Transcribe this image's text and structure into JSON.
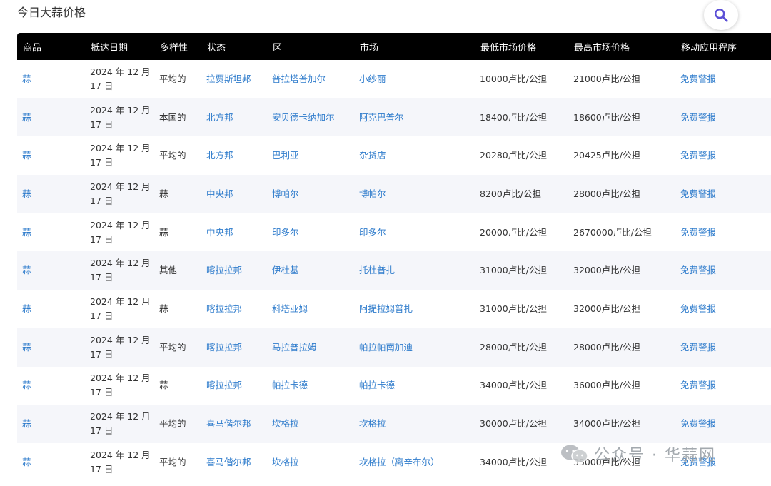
{
  "page_title": "今日大蒜价格",
  "search": {
    "icon": "search-icon",
    "accent": "#5b4fd6"
  },
  "table": {
    "headers": [
      "商品",
      "抵达日期",
      "多样性",
      "状态",
      "区",
      "市场",
      "最低市场价格",
      "最高市场价格",
      "移动应用程序"
    ],
    "rows": [
      {
        "commodity": "蒜",
        "date": "2024 年 12 月 17 日",
        "variety": "平均的",
        "state": "拉贾斯坦邦",
        "district": "普拉塔普加尔",
        "market": "小纱丽",
        "min": "10000卢比/公担",
        "max": "21000卢比/公担",
        "app": "免费警报"
      },
      {
        "commodity": "蒜",
        "date": "2024 年 12 月 17 日",
        "variety": "本国的",
        "state": "北方邦",
        "district": "安贝德卡纳加尔",
        "market": "阿克巴普尔",
        "min": "18400卢比/公担",
        "max": "18600卢比/公担",
        "app": "免费警报"
      },
      {
        "commodity": "蒜",
        "date": "2024 年 12 月 17 日",
        "variety": "平均的",
        "state": "北方邦",
        "district": "巴利亚",
        "market": "杂货店",
        "min": "20280卢比/公担",
        "max": "20425卢比/公担",
        "app": "免费警报"
      },
      {
        "commodity": "蒜",
        "date": "2024 年 12 月 17 日",
        "variety": "蒜",
        "state": "中央邦",
        "district": "博帕尔",
        "market": "博帕尔",
        "min": "8200卢比/公担",
        "max": "28000卢比/公担",
        "app": "免费警报"
      },
      {
        "commodity": "蒜",
        "date": "2024 年 12 月 17 日",
        "variety": "蒜",
        "state": "中央邦",
        "district": "印多尔",
        "market": "印多尔",
        "min": "20000卢比/公担",
        "max": "2670000卢比/公担",
        "app": "免费警报"
      },
      {
        "commodity": "蒜",
        "date": "2024 年 12 月 17 日",
        "variety": "其他",
        "state": "喀拉拉邦",
        "district": "伊杜基",
        "market": "托杜普扎",
        "min": "31000卢比/公担",
        "max": "32000卢比/公担",
        "app": "免费警报"
      },
      {
        "commodity": "蒜",
        "date": "2024 年 12 月 17 日",
        "variety": "蒜",
        "state": "喀拉拉邦",
        "district": "科塔亚姆",
        "market": "阿提拉姆普扎",
        "min": "31000卢比/公担",
        "max": "32000卢比/公担",
        "app": "免费警报"
      },
      {
        "commodity": "蒜",
        "date": "2024 年 12 月 17 日",
        "variety": "平均的",
        "state": "喀拉拉邦",
        "district": "马拉普拉姆",
        "market": "帕拉帕南加迪",
        "min": "28000卢比/公担",
        "max": "28000卢比/公担",
        "app": "免费警报"
      },
      {
        "commodity": "蒜",
        "date": "2024 年 12 月 17 日",
        "variety": "蒜",
        "state": "喀拉拉邦",
        "district": "帕拉卡德",
        "market": "帕拉卡德",
        "min": "34000卢比/公担",
        "max": "36000卢比/公担",
        "app": "免费警报"
      },
      {
        "commodity": "蒜",
        "date": "2024 年 12 月 17 日",
        "variety": "平均的",
        "state": "喜马偕尔邦",
        "district": "坎格拉",
        "market": "坎格拉",
        "min": "30000卢比/公担",
        "max": "34000卢比/公担",
        "app": "免费警报"
      },
      {
        "commodity": "蒜",
        "date": "2024 年 12 月 17 日",
        "variety": "平均的",
        "state": "喜马偕尔邦",
        "district": "坎格拉",
        "market": "坎格拉（离辛布尔）",
        "min": "34000卢比/公担",
        "max": "35000卢比/公担",
        "app": "免费警报"
      }
    ]
  },
  "watermark": {
    "text": "公众号 · 华蒜网",
    "icon": "wechat-icon"
  },
  "colors": {
    "header_bg": "#000000",
    "link": "#2f7ccc",
    "row_alt": "#f5f6fa"
  }
}
